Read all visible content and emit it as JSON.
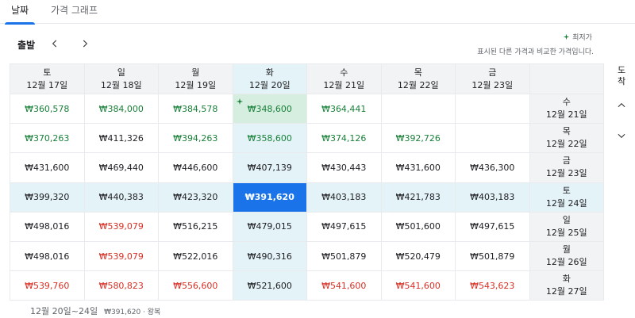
{
  "tabs": [
    {
      "label": "날짜",
      "active": true
    },
    {
      "label": "가격 그래프",
      "active": false
    }
  ],
  "depart_label": "출발",
  "legend": {
    "lowest_label": "최저가",
    "description": "표시된 다른 가격과 비교한 가격입니다."
  },
  "side_label": "도착",
  "columns": [
    {
      "day": "토",
      "date": "12월 17일"
    },
    {
      "day": "일",
      "date": "12월 18일"
    },
    {
      "day": "월",
      "date": "12월 19일"
    },
    {
      "day": "화",
      "date": "12월 20일"
    },
    {
      "day": "수",
      "date": "12월 21일"
    },
    {
      "day": "목",
      "date": "12월 22일"
    },
    {
      "day": "금",
      "date": "12월 23일"
    }
  ],
  "rows": [
    {
      "day": "수",
      "date": "12월 21일",
      "prices": [
        {
          "v": "₩360,578",
          "c": "green"
        },
        {
          "v": "₩384,000",
          "c": "green"
        },
        {
          "v": "₩384,578",
          "c": "green"
        },
        {
          "v": "₩348,600",
          "c": "green",
          "cheapest": true
        },
        {
          "v": "₩364,441",
          "c": "green"
        },
        {
          "v": "",
          "c": ""
        },
        {
          "v": "",
          "c": ""
        }
      ]
    },
    {
      "day": "목",
      "date": "12월 22일",
      "prices": [
        {
          "v": "₩370,263",
          "c": "green"
        },
        {
          "v": "₩411,326",
          "c": ""
        },
        {
          "v": "₩394,263",
          "c": "green"
        },
        {
          "v": "₩358,600",
          "c": "green"
        },
        {
          "v": "₩374,126",
          "c": "green"
        },
        {
          "v": "₩392,726",
          "c": "green"
        },
        {
          "v": "",
          "c": ""
        }
      ]
    },
    {
      "day": "금",
      "date": "12월 23일",
      "prices": [
        {
          "v": "₩431,600",
          "c": ""
        },
        {
          "v": "₩469,440",
          "c": ""
        },
        {
          "v": "₩446,600",
          "c": ""
        },
        {
          "v": "₩407,139",
          "c": ""
        },
        {
          "v": "₩430,443",
          "c": ""
        },
        {
          "v": "₩431,600",
          "c": ""
        },
        {
          "v": "₩436,300",
          "c": ""
        }
      ]
    },
    {
      "day": "토",
      "date": "12월 24일",
      "prices": [
        {
          "v": "₩399,320",
          "c": ""
        },
        {
          "v": "₩440,383",
          "c": ""
        },
        {
          "v": "₩423,320",
          "c": ""
        },
        {
          "v": "₩391,620",
          "c": "",
          "selected": true
        },
        {
          "v": "₩403,183",
          "c": ""
        },
        {
          "v": "₩421,783",
          "c": ""
        },
        {
          "v": "₩403,183",
          "c": ""
        }
      ]
    },
    {
      "day": "일",
      "date": "12월 25일",
      "prices": [
        {
          "v": "₩498,016",
          "c": ""
        },
        {
          "v": "₩539,079",
          "c": "red"
        },
        {
          "v": "₩516,215",
          "c": ""
        },
        {
          "v": "₩479,015",
          "c": ""
        },
        {
          "v": "₩497,615",
          "c": ""
        },
        {
          "v": "₩501,600",
          "c": ""
        },
        {
          "v": "₩497,615",
          "c": ""
        }
      ]
    },
    {
      "day": "월",
      "date": "12월 26일",
      "prices": [
        {
          "v": "₩498,016",
          "c": ""
        },
        {
          "v": "₩539,079",
          "c": "red"
        },
        {
          "v": "₩522,016",
          "c": ""
        },
        {
          "v": "₩490,316",
          "c": ""
        },
        {
          "v": "₩501,879",
          "c": ""
        },
        {
          "v": "₩520,479",
          "c": ""
        },
        {
          "v": "₩501,879",
          "c": ""
        }
      ]
    },
    {
      "day": "화",
      "date": "12월 27일",
      "prices": [
        {
          "v": "₩539,760",
          "c": "red"
        },
        {
          "v": "₩580,823",
          "c": "red"
        },
        {
          "v": "₩556,600",
          "c": "red"
        },
        {
          "v": "₩521,600",
          "c": ""
        },
        {
          "v": "₩541,600",
          "c": "red"
        },
        {
          "v": "₩541,600",
          "c": "red"
        },
        {
          "v": "₩543,623",
          "c": "red"
        }
      ]
    }
  ],
  "footer": {
    "dates": "12월 20일~24일",
    "summary": "₩391,620 · 왕복"
  },
  "colors": {
    "accent": "#1a73e8",
    "cheap": "#188038",
    "expensive": "#d93025"
  },
  "icons": {
    "prev": "chevron-left-icon",
    "next": "chevron-right-icon",
    "up": "chevron-up-icon",
    "down": "chevron-down-icon",
    "spark": "sparkle-icon"
  }
}
